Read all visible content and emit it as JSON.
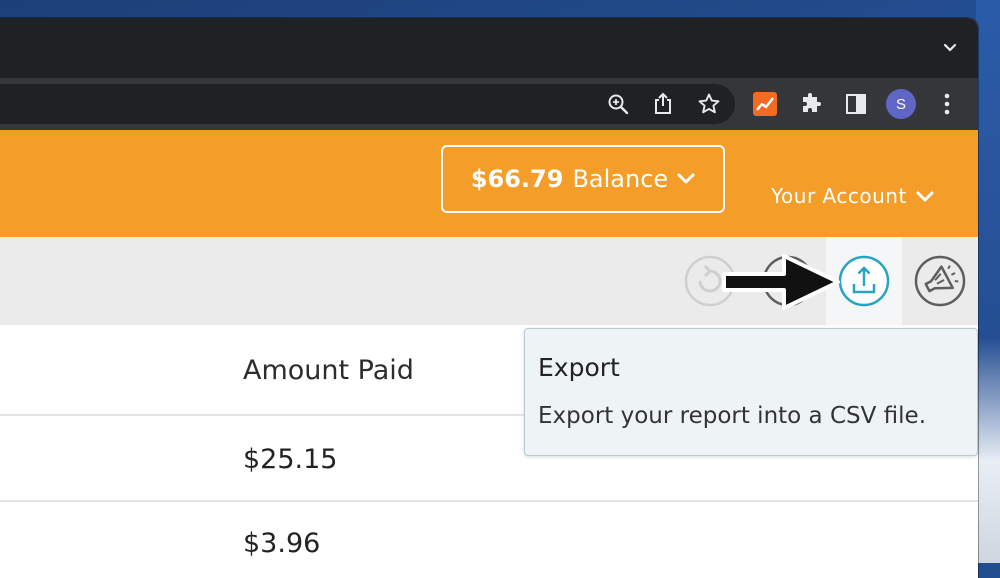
{
  "browser": {
    "icons": [
      "chevron-down-icon",
      "zoom-icon",
      "share-icon",
      "bookmark-star-icon",
      "analytics-extension-icon",
      "extensions-puzzle-icon",
      "side-panel-icon",
      "menu-kebab-icon"
    ],
    "profile_initial": "S"
  },
  "header": {
    "balance_amount": "$66.79",
    "balance_label": "Balance",
    "account_label": "Your Account",
    "brand_color": "#f59d29"
  },
  "actions": {
    "icons": [
      "refresh-icon",
      "clock-icon",
      "export-icon",
      "announce-megaphone-icon"
    ],
    "active": "export-icon",
    "accent_color": "#27a4c4"
  },
  "tooltip": {
    "title": "Export",
    "body": "Export your report into a CSV file."
  },
  "table": {
    "column_header": "Amount Paid",
    "rows": [
      {
        "amount_paid": "$25.15"
      },
      {
        "amount_paid": "$3.96"
      }
    ]
  }
}
